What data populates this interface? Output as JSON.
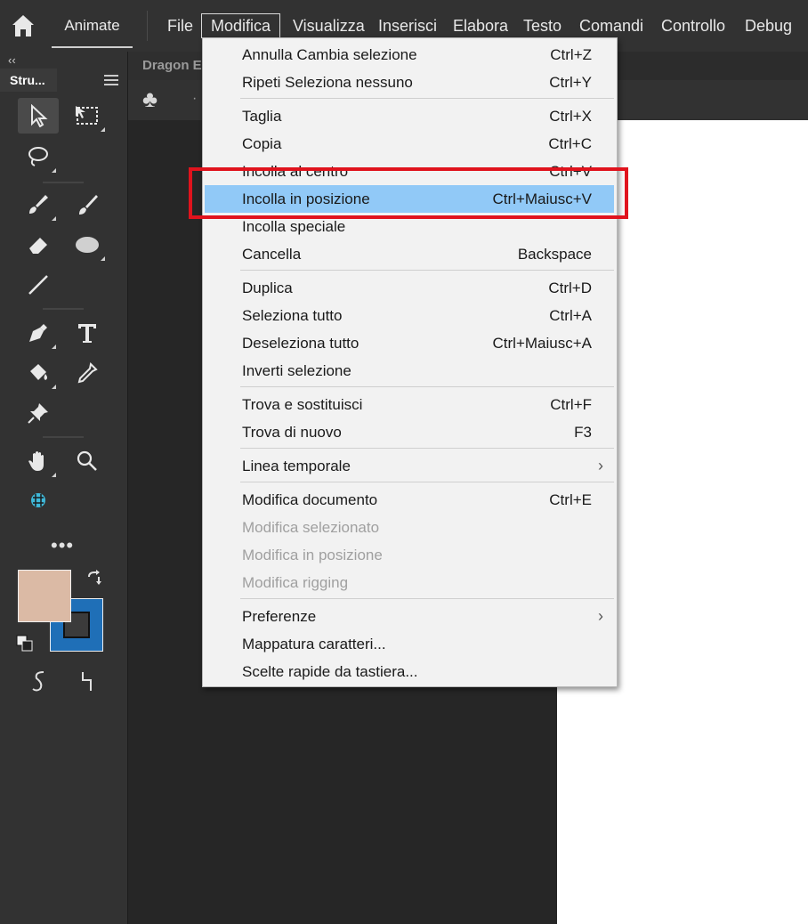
{
  "menubar": {
    "app_name": "Animate",
    "items": [
      "File",
      "Modifica",
      "Visualizza",
      "Inserisci",
      "Elabora",
      "Testo",
      "Comandi",
      "Controllo",
      "Debug"
    ]
  },
  "toolbar": {
    "collapse": "‹‹",
    "tab_label": "Stru...",
    "more": "•••",
    "fill_color": "#dbbaa5",
    "stroke_color": "#1f6fb7"
  },
  "document": {
    "tab_label": "Dragon E",
    "scene_dot": "·"
  },
  "dropdown": {
    "items": [
      {
        "label": "Annulla Cambia selezione",
        "shortcut": "Ctrl+Z"
      },
      {
        "label": "Ripeti Seleziona nessuno",
        "shortcut": "Ctrl+Y"
      },
      {
        "label": "Taglia",
        "shortcut": "Ctrl+X"
      },
      {
        "label": "Copia",
        "shortcut": "Ctrl+C"
      },
      {
        "label": "Incolla al centro",
        "shortcut": "Ctrl+V"
      },
      {
        "label": "Incolla in posizione",
        "shortcut": "Ctrl+Maiusc+V"
      },
      {
        "label": "Incolla speciale",
        "shortcut": ""
      },
      {
        "label": "Cancella",
        "shortcut": "Backspace"
      },
      {
        "label": "Duplica",
        "shortcut": "Ctrl+D"
      },
      {
        "label": "Seleziona tutto",
        "shortcut": "Ctrl+A"
      },
      {
        "label": "Deseleziona tutto",
        "shortcut": "Ctrl+Maiusc+A"
      },
      {
        "label": "Inverti selezione",
        "shortcut": ""
      },
      {
        "label": "Trova e sostituisci",
        "shortcut": "Ctrl+F"
      },
      {
        "label": "Trova di nuovo",
        "shortcut": "F3"
      },
      {
        "label": "Linea temporale",
        "shortcut": ""
      },
      {
        "label": "Modifica documento",
        "shortcut": "Ctrl+E"
      },
      {
        "label": "Modifica selezionato",
        "shortcut": ""
      },
      {
        "label": "Modifica in posizione",
        "shortcut": ""
      },
      {
        "label": "Modifica rigging",
        "shortcut": ""
      },
      {
        "label": "Preferenze",
        "shortcut": ""
      },
      {
        "label": "Mappatura caratteri...",
        "shortcut": ""
      },
      {
        "label": "Scelte rapide da tastiera...",
        "shortcut": ""
      }
    ]
  },
  "colors": {
    "highlight": "#91c9f7",
    "annotation_frame": "#e0131d"
  }
}
